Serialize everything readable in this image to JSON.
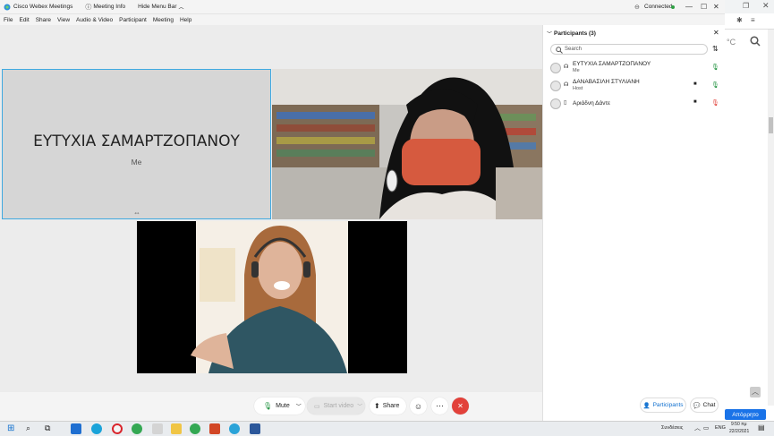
{
  "window": {
    "title": "Cisco Webex Meetings",
    "meeting_info": "Meeting Info",
    "hide_menu_bar": "Hide Menu Bar",
    "status": "Connected"
  },
  "menu": [
    "File",
    "Edit",
    "Share",
    "View",
    "Audio & Video",
    "Participant",
    "Meeting",
    "Help"
  ],
  "stage": {
    "self_name": "ΕΥΤΥΧΙΑ ΣΑΜΑΡΤΖΟΠΑΝΟΥ",
    "self_label": "Me"
  },
  "controls": {
    "mute": "Mute",
    "start_video": "Start video",
    "share": "Share"
  },
  "panel": {
    "title": "Participants (3)",
    "search_placeholder": "Search",
    "participants": [
      {
        "name": "ΕΥΤΥΧΙΑ ΣΑΜΑΡΤΖΟΠΑΝΟΥ",
        "sub": "Me"
      },
      {
        "name": "ΔΑΝΑΒΑΣΙΛΗ ΣΤΥΛΙΑΝΗ",
        "sub": "Host"
      },
      {
        "name": "Αριάδνη Δάντε",
        "sub": ""
      }
    ],
    "footer_participants": "Participants",
    "footer_chat": "Chat"
  },
  "bg_browser": {
    "temp": "°C",
    "page_button": "Απόρρητο"
  },
  "taskbar": {
    "network_label": "Συνδέσεις",
    "lang": "ENG",
    "time": "9:50 πμ",
    "date": "22/2/2021"
  },
  "colors": {
    "accent": "#3fa9e0",
    "leave": "#e2413a",
    "connected": "#2ea043",
    "taskbar": "#e9ecef"
  }
}
